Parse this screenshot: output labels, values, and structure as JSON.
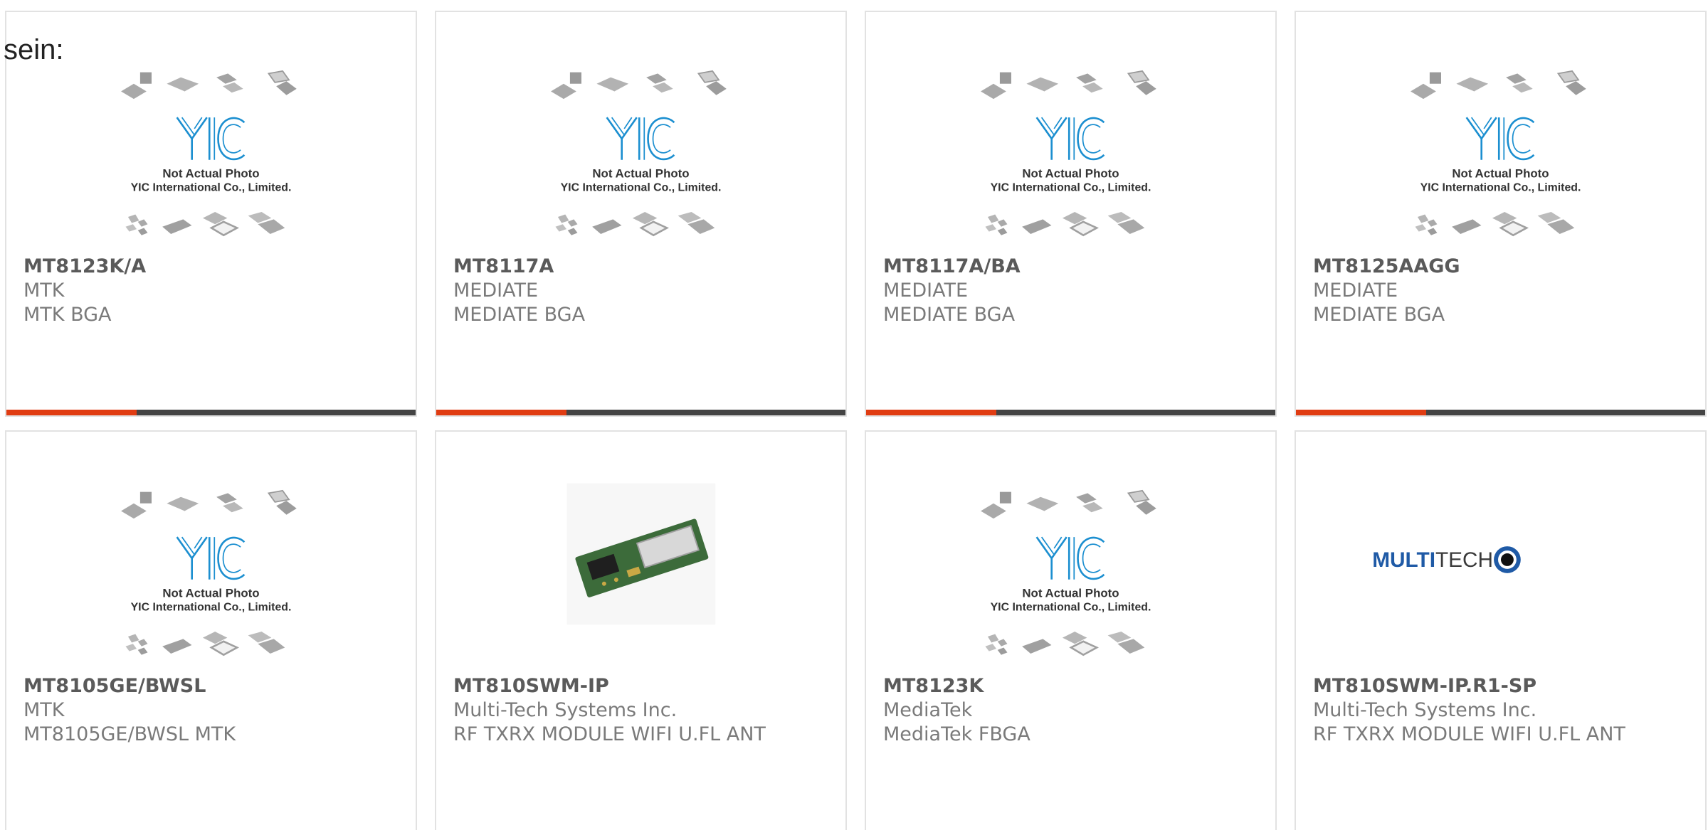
{
  "leading_text": "sein:",
  "placeholder_image": {
    "line1": "Not Actual Photo",
    "line2": "YIC International Co., Limited.",
    "logo_text": "YIC"
  },
  "colors": {
    "accent": "#e03c12",
    "bar": "#444444",
    "logo_blue": "#1c8fd0",
    "multitech_blue": "#1f5aa6"
  },
  "products": [
    {
      "part_number": "MT8123K/A",
      "manufacturer": "MTK",
      "description": "MTK BGA",
      "image": "not-actual-photo"
    },
    {
      "part_number": "MT8117A",
      "manufacturer": "MEDIATE",
      "description": "MEDIATE BGA",
      "image": "not-actual-photo"
    },
    {
      "part_number": "MT8117A/BA",
      "manufacturer": "MEDIATE",
      "description": "MEDIATE BGA",
      "image": "not-actual-photo"
    },
    {
      "part_number": "MT8125AAGG",
      "manufacturer": "MEDIATE",
      "description": "MEDIATE BGA",
      "image": "not-actual-photo"
    },
    {
      "part_number": "MT8105GE/BWSL",
      "manufacturer": "MTK",
      "description": "MT8105GE/BWSL MTK",
      "image": "not-actual-photo"
    },
    {
      "part_number": "MT810SWM-IP",
      "manufacturer": "Multi-Tech Systems Inc.",
      "description": "RF TXRX MODULE WIFI U.FL ANT",
      "image": "module-photo"
    },
    {
      "part_number": "MT8123K",
      "manufacturer": "MediaTek",
      "description": "MediaTek FBGA",
      "image": "not-actual-photo"
    },
    {
      "part_number": "MT810SWM-IP.R1-SP",
      "manufacturer": "Multi-Tech Systems Inc.",
      "description": "RF TXRX MODULE WIFI U.FL ANT",
      "image": "multitech-logo"
    }
  ],
  "multitech_logo": {
    "bold": "MULTI",
    "light": "TECH"
  }
}
